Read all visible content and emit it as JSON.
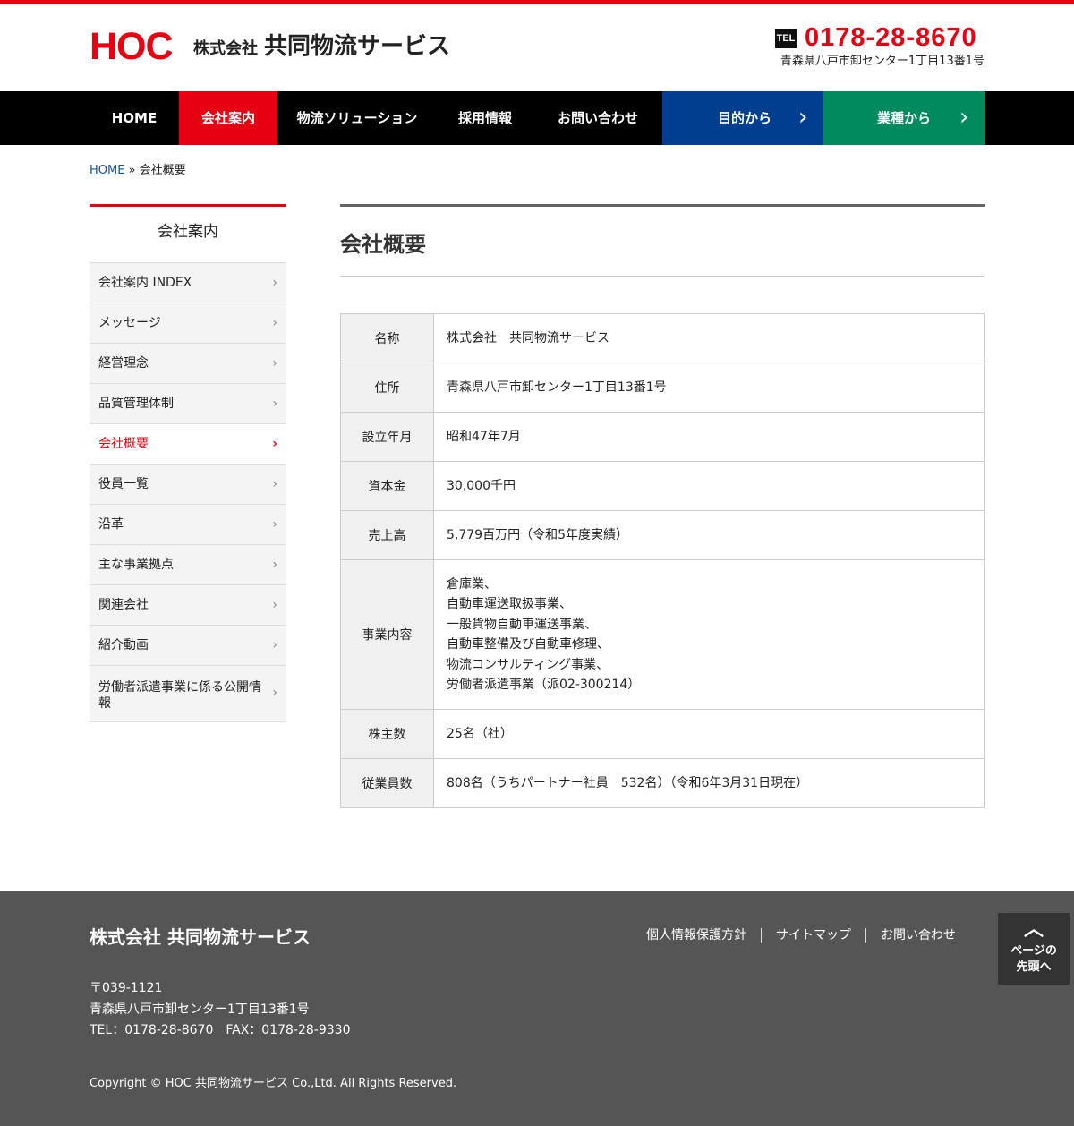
{
  "header": {
    "logo_mark": "HOC",
    "logo_sub": "株式会社",
    "logo_name": "共同物流サービス",
    "tel_icon": "TEL",
    "tel_number": "0178-28-8670",
    "address": "青森県八戸市卸センター1丁目13番1号"
  },
  "nav": {
    "items": [
      {
        "label": "HOME"
      },
      {
        "label": "会社案内"
      },
      {
        "label": "物流ソリューション"
      },
      {
        "label": "採用情報"
      },
      {
        "label": "お問い合わせ"
      },
      {
        "label": "目的から"
      },
      {
        "label": "業種から"
      }
    ],
    "colors": {
      "active": "#e60012",
      "purpose": "#003f8f",
      "industry": "#008a5e",
      "base": "#000000"
    }
  },
  "breadcrumb": {
    "home": "HOME",
    "separator": " » ",
    "current": "会社概要"
  },
  "sidebar": {
    "title": "会社案内",
    "items": [
      {
        "label": "会社案内 INDEX"
      },
      {
        "label": "メッセージ"
      },
      {
        "label": "経営理念"
      },
      {
        "label": "品質管理体制"
      },
      {
        "label": "会社概要"
      },
      {
        "label": "役員一覧"
      },
      {
        "label": "沿革"
      },
      {
        "label": "主な事業拠点"
      },
      {
        "label": "関連会社"
      },
      {
        "label": "紹介動画"
      },
      {
        "label": "労働者派遣事業に係る公開情報"
      }
    ]
  },
  "main": {
    "title": "会社概要",
    "rows": [
      {
        "label": "名称",
        "value": [
          "株式会社　共同物流サービス"
        ]
      },
      {
        "label": "住所",
        "value": [
          "青森県八戸市卸センター1丁目13番1号"
        ]
      },
      {
        "label": "設立年月",
        "value": [
          "昭和47年7月"
        ]
      },
      {
        "label": "資本金",
        "value": [
          "30,000千円"
        ]
      },
      {
        "label": "売上高",
        "value": [
          "5,779百万円（令和5年度実績）"
        ]
      },
      {
        "label": "事業内容",
        "value": [
          "倉庫業、",
          "自動車運送取扱事業、",
          "一般貨物自動車運送事業、",
          "自動車整備及び自動車修理、",
          "物流コンサルティング事業、",
          "労働者派遣事業（派02-300214）"
        ]
      },
      {
        "label": "株主数",
        "value": [
          "25名（社）"
        ]
      },
      {
        "label": "従業員数",
        "value": [
          "808名（うちパートナー社員　532名）（令和6年3月31日現在）"
        ]
      }
    ]
  },
  "footer": {
    "company": "株式会社 共同物流サービス",
    "links": [
      "個人情報保護方針",
      "サイトマップ",
      "お問い合わせ"
    ],
    "postal": "〒039-1121",
    "address": "青森県八戸市卸センター1丁目13番1号",
    "contact": "TEL：0178-28-8670　FAX：0178-28-9330",
    "copyright": "Copyright © HOC 共同物流サービス Co.,Ltd. All Rights Reserved."
  },
  "pagetop": {
    "line1": "ページの",
    "line2": "先頭へ"
  },
  "icons": {
    "chevron": "chevron-right-icon",
    "pagetop": "chevron-up-icon",
    "tel": "tel-icon"
  }
}
